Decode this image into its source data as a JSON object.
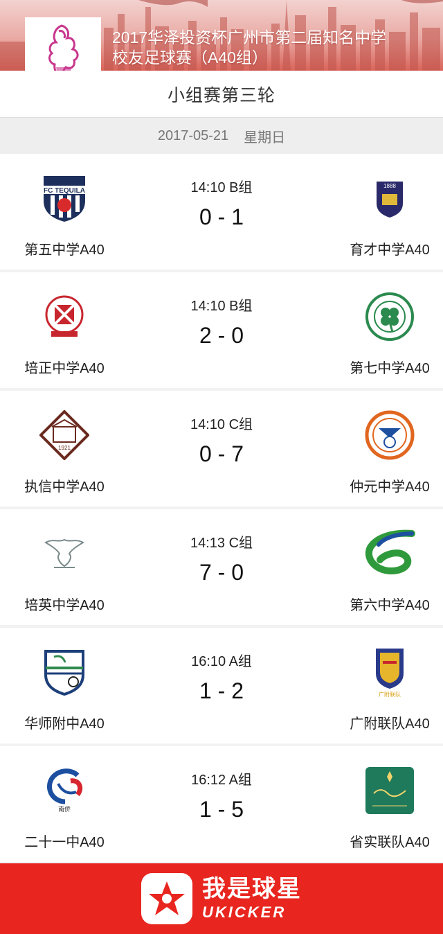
{
  "header": {
    "title_line1": "2017华泽投资杯广州市第二届知名中学",
    "title_line2": "校友足球赛（A40组）"
  },
  "round": {
    "title": "小组赛第三轮"
  },
  "date": {
    "day": "2017-05-21",
    "weekday": "星期日"
  },
  "matches": [
    {
      "time_group": "14:10 B组",
      "score": "0 - 1",
      "home": {
        "name": "第五中学A40",
        "crest_text": "FC TEQUILA"
      },
      "away": {
        "name": "育才中学A40",
        "crest_text": "1888"
      }
    },
    {
      "time_group": "14:10 B组",
      "score": "2 - 0",
      "home": {
        "name": "培正中学A40"
      },
      "away": {
        "name": "第七中学A40"
      }
    },
    {
      "time_group": "14:10 C组",
      "score": "0 - 7",
      "home": {
        "name": "执信中学A40",
        "crest_text": "1921"
      },
      "away": {
        "name": "仲元中学A40"
      }
    },
    {
      "time_group": "14:13 C组",
      "score": "7 - 0",
      "home": {
        "name": "培英中学A40"
      },
      "away": {
        "name": "第六中学A40"
      }
    },
    {
      "time_group": "16:10 A组",
      "score": "1 - 2",
      "home": {
        "name": "华师附中A40"
      },
      "away": {
        "name": "广附联队A40",
        "crest_text": "广附联队"
      }
    },
    {
      "time_group": "16:12 A组",
      "score": "1 - 5",
      "home": {
        "name": "二十一中A40",
        "crest_text": "南侨"
      },
      "away": {
        "name": "省实联队A40"
      }
    }
  ],
  "footer": {
    "brand_cn": "我是球星",
    "brand_en": "UKICKER"
  },
  "colors": {
    "brand_red": "#e8261f",
    "banner_red": "#d9645a"
  },
  "icons": {
    "event_logo": "phoenix-trophy-icon",
    "app_logo": "star-icon"
  }
}
